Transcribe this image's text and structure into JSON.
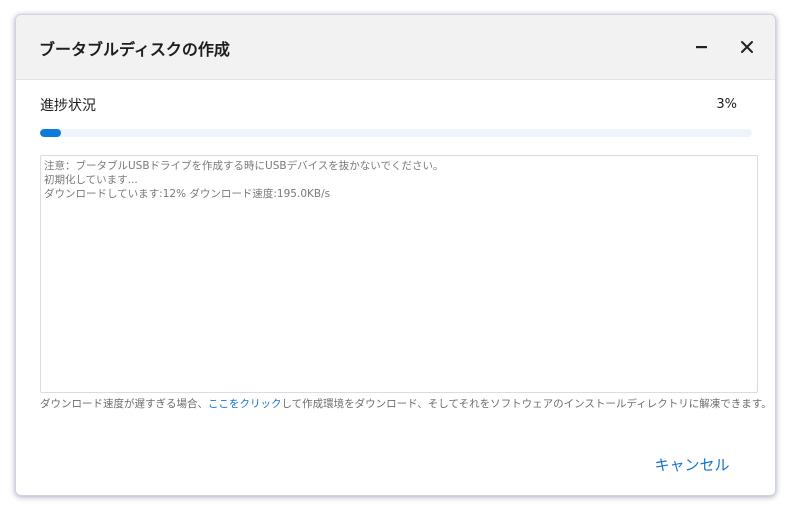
{
  "window": {
    "title": "ブータブルディスクの作成",
    "minimize_icon": "minimize-icon",
    "close_icon": "close-icon"
  },
  "progress": {
    "label": "進捗状況",
    "percent_text": "3%",
    "value": 0.03,
    "color": "#0b7bdc",
    "track_color": "#eef4fb"
  },
  "log": {
    "lines": [
      "注意：ブータブルUSBドライブを作成する時にUSBデバイスを抜かないでください。",
      "初期化しています...",
      "ダウンロードしています:12%   ダウンロード速度:195.0KB/s"
    ]
  },
  "hint": {
    "prefix": "ダウンロード速度が遅すぎる場合、",
    "link": "ここをクリック",
    "suffix": "して作成環境をダウンロード、そしてそれをソフトウェアのインストールディレクトリに解凍できます。"
  },
  "footer": {
    "cancel_label": "キャンセル"
  },
  "colors": {
    "accent": "#1573d6",
    "titlebar": "#f2f2f2"
  }
}
